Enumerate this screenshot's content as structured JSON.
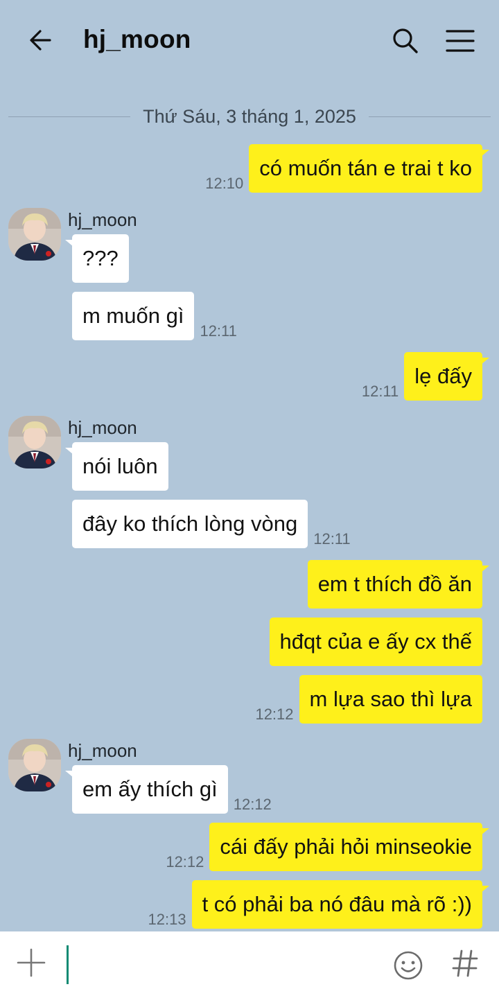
{
  "header": {
    "title": "hj_moon"
  },
  "date_divider": "Thứ Sáu, 3 tháng 1, 2025",
  "sender_name": "hj_moon",
  "messages": [
    {
      "text": "có muốn tán e trai t ko",
      "time": "12:10"
    },
    {
      "text": "???",
      "time": ""
    },
    {
      "text": "m muốn gì",
      "time": "12:11"
    },
    {
      "text": "lẹ đấy",
      "time": "12:11"
    },
    {
      "text": "nói luôn",
      "time": ""
    },
    {
      "text": "đây ko thích lòng vòng",
      "time": "12:11"
    },
    {
      "text": "em t thích đồ ăn",
      "time": ""
    },
    {
      "text": "hđqt của e ấy cx thế",
      "time": ""
    },
    {
      "text": "m lựa sao thì lựa",
      "time": "12:12"
    },
    {
      "text": "em ấy thích gì",
      "time": "12:12"
    },
    {
      "text": "cái đấy phải hỏi minseokie",
      "time": "12:12"
    },
    {
      "text": "t có phải ba nó đâu mà rõ :))",
      "time": "12:13"
    }
  ],
  "input": {
    "placeholder": ""
  },
  "icons": {
    "back": "arrow-left-icon",
    "search": "search-icon",
    "menu": "hamburger-menu-icon",
    "add": "plus-icon",
    "emoji": "smiley-icon",
    "hashtag": "hash-icon"
  },
  "colors": {
    "background": "#b1c6d9",
    "outgoing_bubble": "#fef01b",
    "incoming_bubble": "#ffffff",
    "caret": "#0e8a73"
  }
}
